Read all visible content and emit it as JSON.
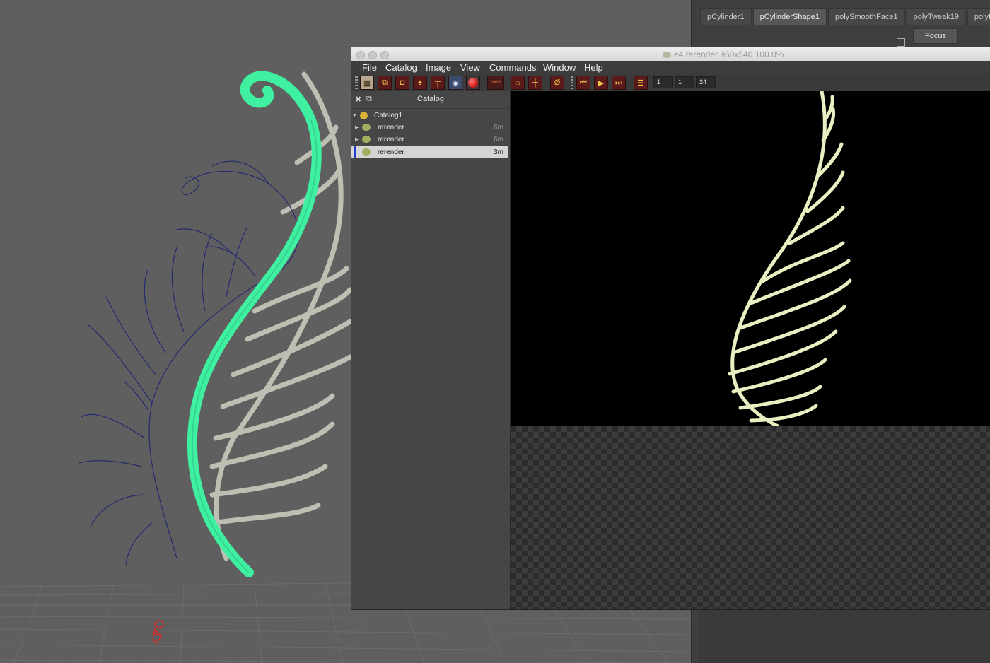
{
  "attribute_editor": {
    "tabs": [
      {
        "label": "pCylinder1"
      },
      {
        "label": "pCylinderShape1",
        "active": true
      },
      {
        "label": "polySmoothFace1"
      },
      {
        "label": "polyTweak19"
      },
      {
        "label": "polyExtru"
      }
    ],
    "focus_label": "Focus"
  },
  "window": {
    "title": "e4 rerender 960x540 100.0%"
  },
  "menu": [
    "File",
    "Catalog",
    "Image",
    "View",
    "Commands",
    "Window",
    "Help"
  ],
  "toolbar": {
    "zoom_label": "100%",
    "frame_start": "1",
    "frame_current": "1",
    "frame_end": "24"
  },
  "catalog": {
    "title": "Catalog",
    "root": "Catalog1",
    "items": [
      {
        "label": "rerender",
        "age": "6m",
        "selected": false
      },
      {
        "label": "rerender",
        "age": "6m",
        "selected": false
      },
      {
        "label": "rerender",
        "age": "3m",
        "selected": true
      }
    ]
  },
  "colors": {
    "viewport_bg": "#5f5f5f",
    "selected_curve": "#3ef0a0",
    "wire_curve": "#2a2f7a",
    "render_fern": "#e6f0c0",
    "selection_mark": "#1d3fd0"
  }
}
